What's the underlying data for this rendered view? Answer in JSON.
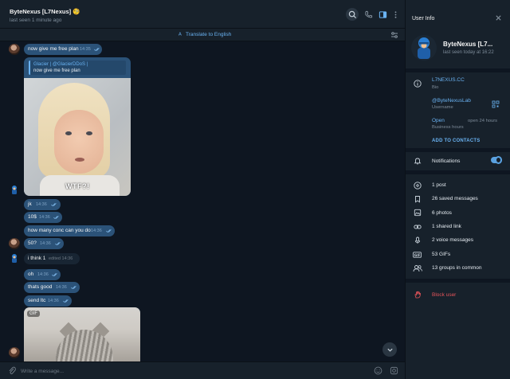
{
  "header": {
    "title": "ByteNexus [L7Nexus] 🧐",
    "status": "last seen 1 minute ago"
  },
  "translate_bar": {
    "label": "Translate to English"
  },
  "messages": [
    {
      "text": "now give me free plan",
      "time": "14:35",
      "direction": "out"
    },
    {
      "reply_name": "Glacier | @GlacierDDoS |",
      "reply_text": "now give me free plan",
      "image_caption": "WTF?!"
    },
    {
      "text": "jk",
      "time": "14:36",
      "direction": "out"
    },
    {
      "text": "10$",
      "time": "14:36",
      "direction": "out"
    },
    {
      "text": "how many conc can you do",
      "time": "14:36",
      "direction": "out"
    },
    {
      "text": "50?",
      "time": "14:36",
      "direction": "out"
    },
    {
      "text": "i think 1",
      "time": "edited 14:36",
      "direction": "in"
    },
    {
      "text": "oh",
      "time": "14:36",
      "direction": "out"
    },
    {
      "text": "thats good",
      "time": "14:36",
      "direction": "out"
    },
    {
      "text": "send ltc",
      "time": "14:36",
      "direction": "out"
    },
    {
      "gif_badge": "GIF"
    }
  ],
  "composer": {
    "placeholder": "Write a message..."
  },
  "sidebar": {
    "title": "User Info",
    "profile": {
      "name": "ByteNexus [L7...",
      "status": "last seen today at 16:22"
    },
    "bio": {
      "value": "L7NEXUS.CC",
      "label": "Bio"
    },
    "username": {
      "value": "@ByteNexusLab",
      "label": "Username"
    },
    "business": {
      "value": "Open",
      "extra": "open 24 hours",
      "label": "Business hours"
    },
    "add_contacts": "ADD TO CONTACTS",
    "notifications": {
      "label": "Notifications",
      "enabled": true
    },
    "stats": [
      {
        "label": "1 post",
        "icon": "post-icon"
      },
      {
        "label": "26 saved messages",
        "icon": "saved-icon"
      },
      {
        "label": "6 photos",
        "icon": "photo-icon"
      },
      {
        "label": "1 shared link",
        "icon": "link-icon"
      },
      {
        "label": "2 voice messages",
        "icon": "mic-icon"
      },
      {
        "label": "53 GIFs",
        "icon": "gif-icon"
      },
      {
        "label": "13 groups in common",
        "icon": "group-icon"
      }
    ],
    "block": "Block user"
  },
  "colors": {
    "bg": "#0e1621",
    "panel": "#17212b",
    "bubble_out": "#2b5278",
    "bubble_in": "#182533",
    "accent": "#6ab3f3",
    "danger": "#e5545a"
  }
}
